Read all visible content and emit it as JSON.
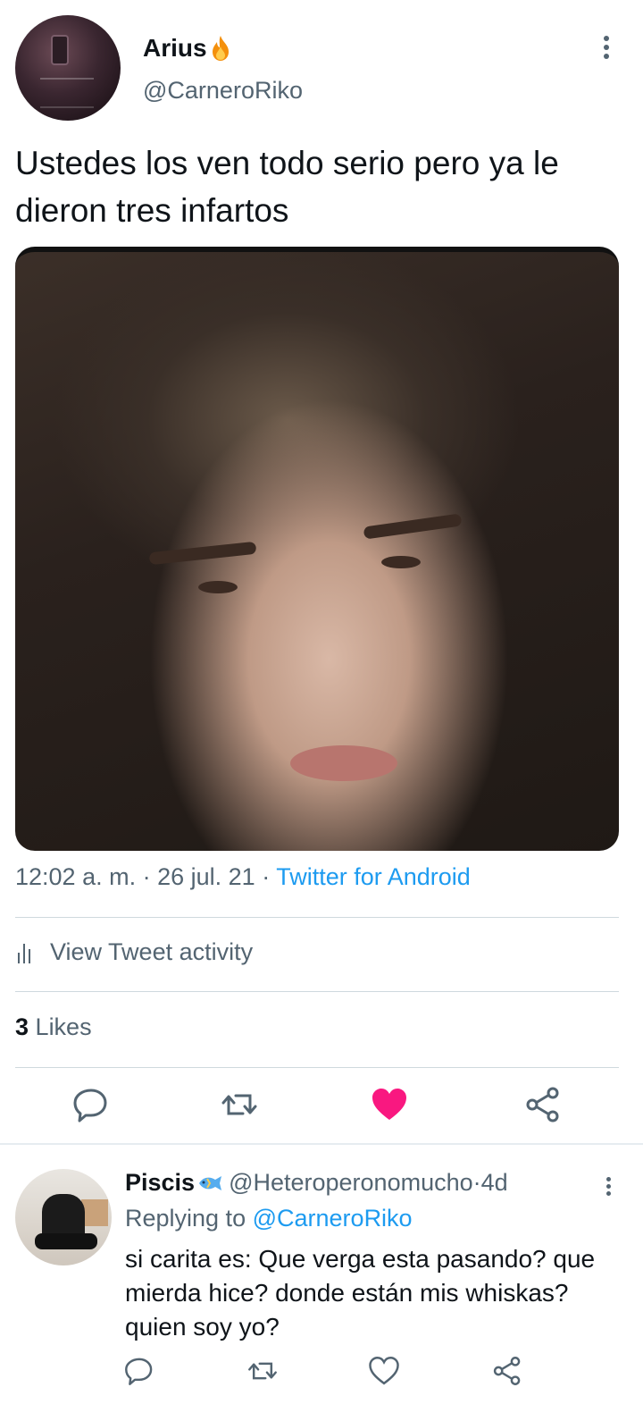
{
  "tweet": {
    "author_name": "Arius",
    "author_handle": "@CarneroRiko",
    "text": "Ustedes los ven todo serio pero ya le dieron tres infartos",
    "time": "12:02 a. m.",
    "date": "26 jul. 21",
    "source": "Twitter for Android",
    "separator": " · "
  },
  "activity": {
    "label": "View Tweet activity"
  },
  "likes": {
    "count": "3",
    "label": "Likes"
  },
  "actions": [
    "reply-icon",
    "retweet-icon",
    "heart-filled-icon",
    "share-icon"
  ],
  "colors": {
    "link": "#1d9bf0",
    "like": "#f91880",
    "secondary_text": "#536471",
    "primary_text": "#0f1419"
  },
  "reply": {
    "author_name": "Piscis",
    "author_handle": "@Heteroperonomucho",
    "age": "4d",
    "replying_to_label": "Replying to",
    "replying_to_handle": "@CarneroRiko",
    "text": "si carita es: Que verga esta pasando? que mierda hice? donde están mis whiskas? quien soy yo?"
  }
}
